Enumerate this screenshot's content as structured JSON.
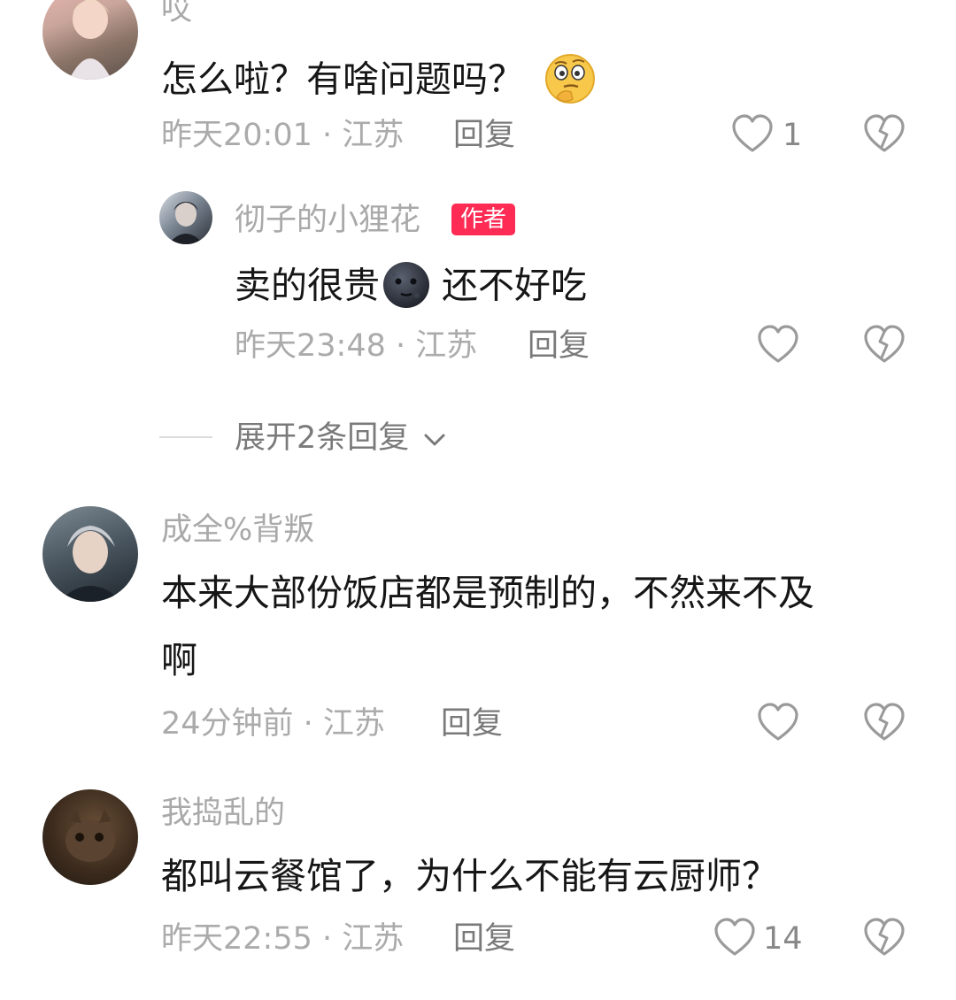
{
  "comments": [
    {
      "username": "哎",
      "text": "怎么啦？有啥问题吗？",
      "emoji": "thinking-face-emoji",
      "time_location": "昨天20:01 · 江苏",
      "reply_label": "回复",
      "likes": "1"
    },
    {
      "username": "彻子的小狸花",
      "badge": "作者",
      "text_before_emoji": "卖的很贵",
      "emoji": "new-moon-face-emoji",
      "text_after_emoji": "还不好吃",
      "time_location": "昨天23:48 · 江苏",
      "reply_label": "回复"
    },
    {
      "username": "成全%背叛",
      "text_line1": "本来大部份饭店都是预制的，不然来不及",
      "text_line2": "啊",
      "time_location": "24分钟前 · 江苏",
      "reply_label": "回复"
    },
    {
      "username": "我捣乱的",
      "text": "都叫云餐馆了，为什么不能有云厨师？",
      "time_location": "昨天22:55 · 江苏",
      "reply_label": "回复",
      "likes": "14"
    }
  ],
  "expand_replies_label": "展开2条回复",
  "colors": {
    "badge": "#fe2c55",
    "username": "#a9a9a9",
    "text": "#161616",
    "meta": "#ababab"
  }
}
